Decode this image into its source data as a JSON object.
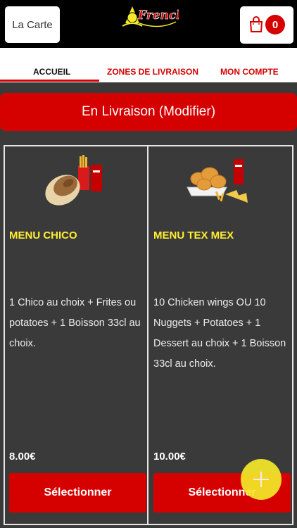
{
  "header": {
    "carte_label": "La Carte",
    "cart_count": "0",
    "logo_text": "French",
    "cart_icon": "shopping-bag-icon"
  },
  "tabs": [
    {
      "label": "ACCUEIL",
      "active": true
    },
    {
      "label": "ZONES DE LIVRAISON",
      "active": false
    },
    {
      "label": "MON COMPTE",
      "active": false
    }
  ],
  "delivery_banner": "En Livraison (Modifier)",
  "products": [
    {
      "title": "MENU CHICO",
      "description": "1 Chico au choix  + Frites ou potatoes  + 1 Boisson 33cl au choix.",
      "price": "8.00€",
      "button": "Sélectionner"
    },
    {
      "title": "MENU TEX MEX",
      "description": "10 Chicken wings OU 10 Nuggets  + Potatoes  + 1 Dessert au choix  + 1 Boisson 33cl au choix.",
      "price": "10.00€",
      "button": "Sélectionner"
    }
  ],
  "fab_icon": "plus-icon",
  "colors": {
    "accent": "#d50000",
    "title_yellow": "#ffee33",
    "background": "#3a3a3a",
    "fab": "#f5e92a"
  }
}
